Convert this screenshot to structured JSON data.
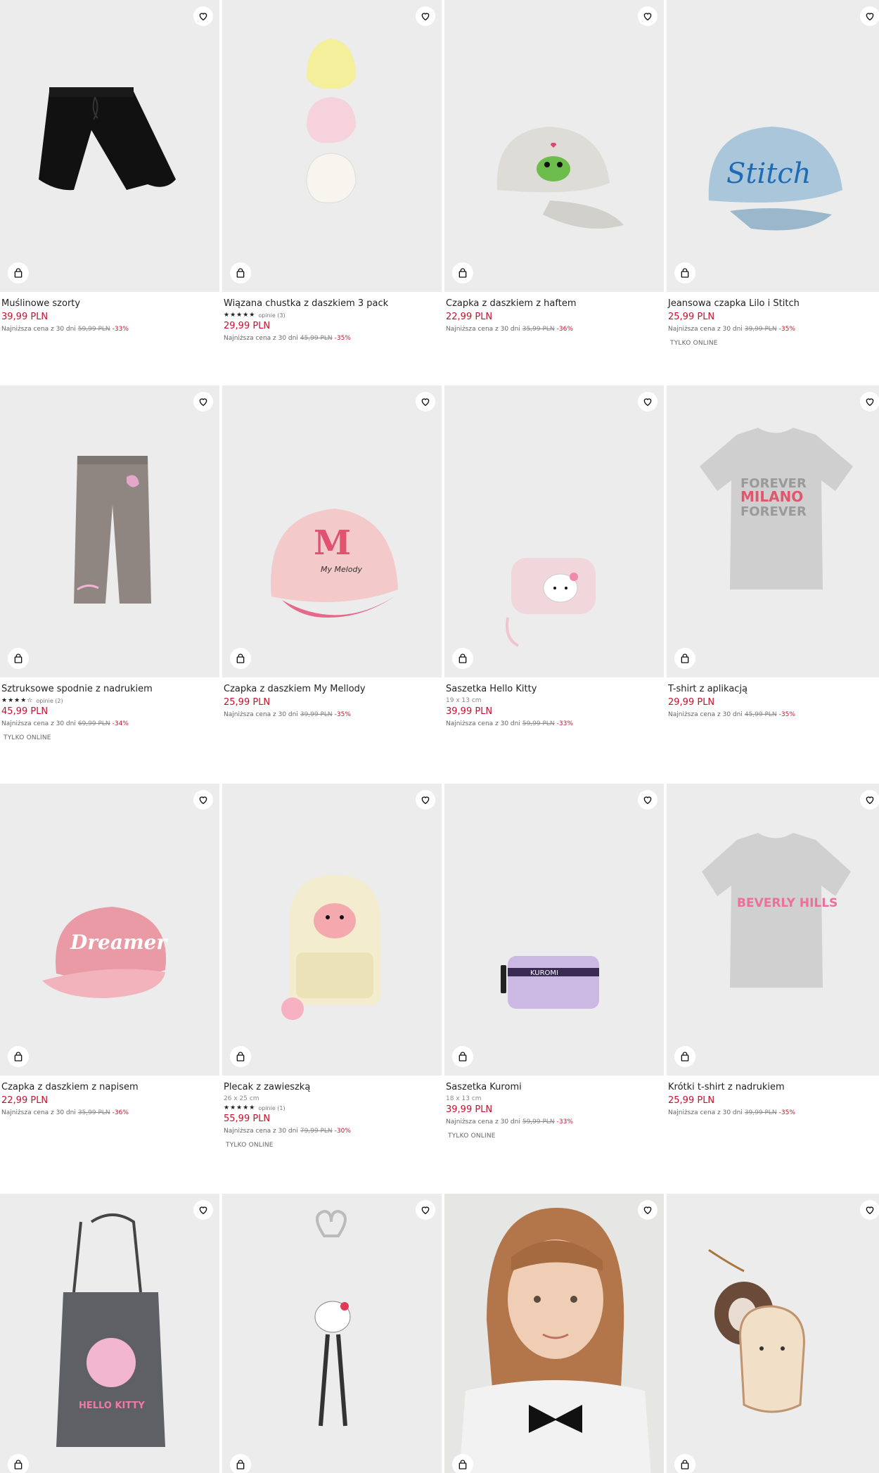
{
  "products": [
    {
      "name": "Muślinowe szorty",
      "price": "39,99 PLN",
      "lowest_label": "Najniższa cena z 30 dni",
      "old_price": "59,99 PLN",
      "discount": "-33%"
    },
    {
      "name": "Wiązana chustka z daszkiem 3 pack",
      "stars": "★★★★★",
      "reviews": "opinie (3)",
      "price": "29,99 PLN",
      "lowest_label": "Najniższa cena z 30 dni",
      "old_price": "45,99 PLN",
      "discount": "-35%"
    },
    {
      "name": "Czapka z daszkiem z haftem",
      "price": "22,99 PLN",
      "lowest_label": "Najniższa cena z 30 dni",
      "old_price": "35,99 PLN",
      "discount": "-36%"
    },
    {
      "name": "Jeansowa czapka Lilo i Stitch",
      "price": "25,99 PLN",
      "lowest_label": "Najniższa cena z 30 dni",
      "old_price": "39,99 PLN",
      "discount": "-35%",
      "badge": "TYLKO ONLINE"
    },
    {
      "name": "Sztruksowe spodnie z nadrukiem",
      "stars": "★★★★☆",
      "reviews": "opinie (2)",
      "price": "45,99 PLN",
      "lowest_label": "Najniższa cena z 30 dni",
      "old_price": "69,99 PLN",
      "discount": "-34%",
      "badge": "TYLKO ONLINE"
    },
    {
      "name": "Czapka z daszkiem My Mellody",
      "price": "25,99 PLN",
      "lowest_label": "Najniższa cena z 30 dni",
      "old_price": "39,99 PLN",
      "discount": "-35%"
    },
    {
      "name": "Saszetka Hello Kitty",
      "dims": "19 x 13 cm",
      "price": "39,99 PLN",
      "lowest_label": "Najniższa cena z 30 dni",
      "old_price": "59,99 PLN",
      "discount": "-33%"
    },
    {
      "name": "T-shirt z aplikacją",
      "price": "29,99 PLN",
      "lowest_label": "Najniższa cena z 30 dni",
      "old_price": "45,99 PLN",
      "discount": "-35%"
    },
    {
      "name": "Czapka z daszkiem z napisem",
      "price": "22,99 PLN",
      "lowest_label": "Najniższa cena z 30 dni",
      "old_price": "35,99 PLN",
      "discount": "-36%"
    },
    {
      "name": "Plecak z zawieszką",
      "dims": "26 x 25 cm",
      "stars": "★★★★★",
      "reviews": "opinie (1)",
      "price": "55,99 PLN",
      "lowest_label": "Najniższa cena z 30 dni",
      "old_price": "79,99 PLN",
      "discount": "-30%",
      "badge": "TYLKO ONLINE"
    },
    {
      "name": "Saszetka Kuromi",
      "dims": "18 x 13 cm",
      "price": "39,99 PLN",
      "lowest_label": "Najniższa cena z 30 dni",
      "old_price": "59,99 PLN",
      "discount": "-33%",
      "badge": "TYLKO ONLINE"
    },
    {
      "name": "Krótki t-shirt z nadrukiem",
      "price": "25,99 PLN",
      "lowest_label": "Najniższa cena z 30 dni",
      "old_price": "39,99 PLN",
      "discount": "-35%"
    },
    {},
    {},
    {},
    {}
  ],
  "print_text": {
    "milano": "MILANO",
    "forever": "FOREVER",
    "beverly": "BEVERLY HILLS",
    "dreamer": "Dreamer",
    "stitch": "Stitch",
    "kuromi": "KUROMI",
    "my_melody": "My Melody",
    "hello_kitty": "HELLO KITTY"
  },
  "icons": {
    "favorite": "heart-icon",
    "add_to_cart": "shopping-bag-icon"
  },
  "colors": {
    "price": "#c8102e",
    "background": "#ececec"
  }
}
